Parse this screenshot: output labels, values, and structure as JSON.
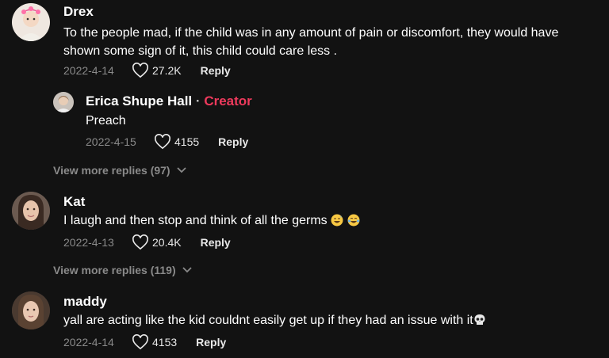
{
  "comments": [
    {
      "username": "Drex",
      "text": "To the people mad, if the child was in any amount of pain or discomfort, they would have shown some sign of it, this child could care less .",
      "date": "2022-4-14",
      "likes": "27.2K",
      "reply_label": "Reply",
      "reply": {
        "username": "Erica Shupe Hall",
        "separator": "·",
        "badge": "Creator",
        "text": "Preach",
        "date": "2022-4-15",
        "likes": "4155",
        "reply_label": "Reply"
      },
      "view_more": "View more replies (97)"
    },
    {
      "username": "Kat",
      "text": "I laugh and then stop and think of all the germs",
      "date": "2022-4-13",
      "likes": "20.4K",
      "reply_label": "Reply",
      "view_more": "View more replies (119)"
    },
    {
      "username": "maddy",
      "text": "yall are acting like the kid couldnt easily get up if they had an issue with it",
      "date": "2022-4-14",
      "likes": "4153",
      "reply_label": "Reply"
    }
  ],
  "icons": {
    "like": "heart-outline-icon",
    "expand": "chevron-down-icon",
    "emoji_sweat": "grinning-sweat-emoji",
    "emoji_tears": "tears-of-joy-emoji",
    "emoji_skull": "skull-emoji"
  },
  "colors": {
    "background": "#121212",
    "creator_badge": "#ee3a5c",
    "muted": "#8a8a8a"
  }
}
